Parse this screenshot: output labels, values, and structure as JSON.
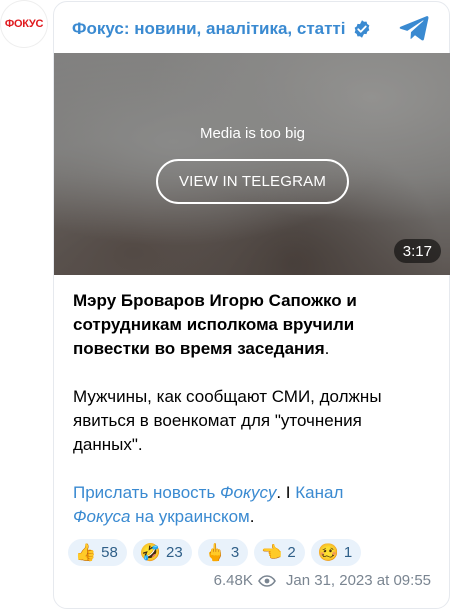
{
  "avatar": {
    "logo_text": "ФОКУС",
    "color": "#e0191e"
  },
  "header": {
    "channel_name": "Фокус: новини, аналітика, статті",
    "verified_icon": "verified-badge-icon",
    "app_icon": "telegram-icon",
    "accent": "#3a8ad1"
  },
  "media": {
    "note": "Media is too big",
    "view_button": "VIEW IN TELEGRAM",
    "duration": "3:17"
  },
  "post": {
    "headline": "Мэру Броваров Игорю Сапожко и сотрудникам исполкома вручили повестки во время заседания",
    "headline_end": ".",
    "body": "Мужчины, как сообщают СМИ, должны явиться в военкомат для \"уточнения данных\".",
    "links": {
      "send_news_prefix": "Прислать новость ",
      "send_news_italic": "Фокусу",
      "separator": ". I ",
      "channel_prefix": "Канал",
      "channel_italic": "Фокуса",
      "channel_suffix": " на украинском",
      "end": "."
    }
  },
  "reactions": [
    {
      "emoji": "👍",
      "count": "58"
    },
    {
      "emoji": "🤣",
      "count": "23"
    },
    {
      "emoji": "🖕",
      "count": "3"
    },
    {
      "emoji": "👈",
      "count": "2"
    },
    {
      "emoji": "🥴",
      "count": "1"
    }
  ],
  "footer": {
    "views": "6.48K",
    "views_icon": "eye-icon",
    "date": "Jan 31, 2023 at 09:55"
  }
}
